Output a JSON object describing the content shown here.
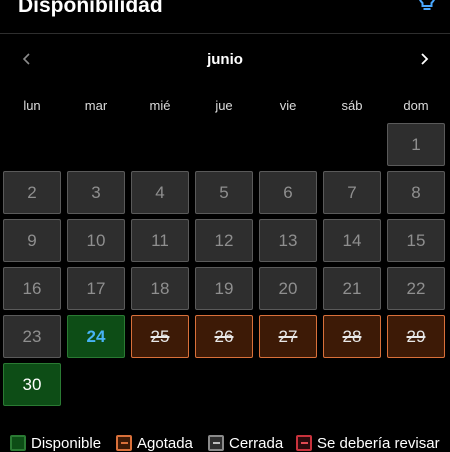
{
  "header": {
    "title": "Disponibilidad",
    "icon": "lightbulb-icon"
  },
  "calendar": {
    "month": "junio",
    "weekdays": [
      "lun",
      "mar",
      "mié",
      "jue",
      "vie",
      "sáb",
      "dom"
    ],
    "rows": [
      [
        null,
        null,
        null,
        null,
        null,
        null,
        {
          "day": "1",
          "status": "closed"
        }
      ],
      [
        {
          "day": "2",
          "status": "closed"
        },
        {
          "day": "3",
          "status": "closed"
        },
        {
          "day": "4",
          "status": "closed"
        },
        {
          "day": "5",
          "status": "closed"
        },
        {
          "day": "6",
          "status": "closed"
        },
        {
          "day": "7",
          "status": "closed"
        },
        {
          "day": "8",
          "status": "closed"
        }
      ],
      [
        {
          "day": "9",
          "status": "closed"
        },
        {
          "day": "10",
          "status": "closed"
        },
        {
          "day": "11",
          "status": "closed"
        },
        {
          "day": "12",
          "status": "closed"
        },
        {
          "day": "13",
          "status": "closed"
        },
        {
          "day": "14",
          "status": "closed"
        },
        {
          "day": "15",
          "status": "closed"
        }
      ],
      [
        {
          "day": "16",
          "status": "closed"
        },
        {
          "day": "17",
          "status": "closed"
        },
        {
          "day": "18",
          "status": "closed"
        },
        {
          "day": "19",
          "status": "closed"
        },
        {
          "day": "20",
          "status": "closed"
        },
        {
          "day": "21",
          "status": "closed"
        },
        {
          "day": "22",
          "status": "closed"
        }
      ],
      [
        {
          "day": "23",
          "status": "closed"
        },
        {
          "day": "24",
          "status": "available",
          "today": true
        },
        {
          "day": "25",
          "status": "sold-out"
        },
        {
          "day": "26",
          "status": "sold-out"
        },
        {
          "day": "27",
          "status": "sold-out"
        },
        {
          "day": "28",
          "status": "sold-out"
        },
        {
          "day": "29",
          "status": "sold-out"
        }
      ],
      [
        {
          "day": "30",
          "status": "available"
        },
        null,
        null,
        null,
        null,
        null,
        null
      ]
    ]
  },
  "legend": [
    {
      "label": "Disponible",
      "border": "#2a7a33",
      "fill": "#0d4d16",
      "dash": false
    },
    {
      "label": "Agotada",
      "border": "#d9703a",
      "fill": "#3d1a06",
      "dash": true,
      "dash_color": "#d9703a"
    },
    {
      "label": "Cerrada",
      "border": "#8a8a8a",
      "fill": "#2e2e2e",
      "dash": true,
      "dash_color": "#bdbdbd"
    },
    {
      "label": "Se debería revisar",
      "border": "#c8323c",
      "fill": "#2a0a0c",
      "dash": true,
      "dash_color": "#e04a52"
    }
  ],
  "colors": {
    "background": "#000000",
    "available": "#0d4d16",
    "sold_out": "#d9703a",
    "closed": "#2e2e2e",
    "today_text": "#47b3f5"
  }
}
